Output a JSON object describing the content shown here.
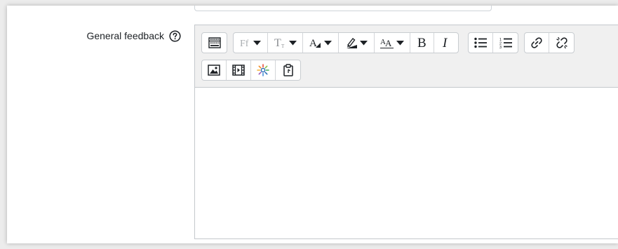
{
  "form": {
    "field_label": "General feedback",
    "help_icon": "question-circle-icon"
  },
  "editor": {
    "toolbar_row1": [
      {
        "name": "show-more-buttons",
        "icon": "toolbar-toggle-icon"
      },
      {
        "name": "font-family",
        "icon": "font-family-icon",
        "dropdown": true,
        "disabled": true
      },
      {
        "name": "font-size",
        "icon": "font-size-icon",
        "dropdown": true,
        "disabled": true
      },
      {
        "name": "font-color",
        "icon": "font-color-icon",
        "dropdown": true
      },
      {
        "name": "background-color",
        "icon": "highlight-icon",
        "dropdown": true
      },
      {
        "name": "text-style",
        "icon": "text-style-icon",
        "dropdown": true
      },
      {
        "name": "bold",
        "icon": "bold-icon"
      },
      {
        "name": "italic",
        "icon": "italic-icon"
      },
      {
        "name": "unordered-list",
        "icon": "bullet-list-icon"
      },
      {
        "name": "ordered-list",
        "icon": "numbered-list-icon"
      },
      {
        "name": "link",
        "icon": "link-icon"
      },
      {
        "name": "unlink",
        "icon": "unlink-icon"
      }
    ],
    "toolbar_row2": [
      {
        "name": "insert-image",
        "icon": "image-icon"
      },
      {
        "name": "insert-media",
        "icon": "film-icon"
      },
      {
        "name": "recordrtc",
        "icon": "recordrtc-icon"
      },
      {
        "name": "manage-files",
        "icon": "clipboard-icon"
      }
    ],
    "content": ""
  },
  "colors": {
    "toolbar_bg": "#f0f0f0",
    "border": "#c4c8cc",
    "text": "#1d2125"
  }
}
